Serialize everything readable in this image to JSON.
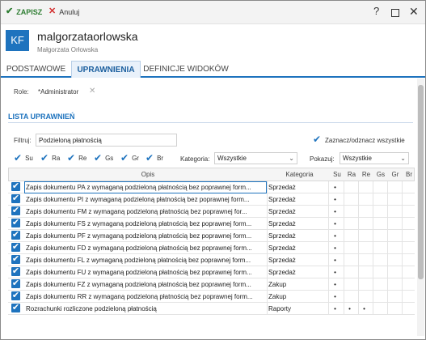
{
  "toolbar": {
    "save_label": "ZAPISZ",
    "cancel_label": "Anuluj",
    "help": "?"
  },
  "user": {
    "initials": "KF",
    "login": "malgorzataorlowska",
    "full_name": "Małgorzata Orłowska"
  },
  "tabs": [
    "PODSTAWOWE",
    "UPRAWNIENIA",
    "DEFINICJE WIDOKÓW"
  ],
  "roles": {
    "label": "Role:",
    "value": "*Administrator"
  },
  "section": {
    "title": "LISTA UPRAWNIEŃ"
  },
  "filter": {
    "label": "Filtruj:",
    "value": "Podzieloną płatnością",
    "select_all_label": "Zaznacz/odznacz wszystkie"
  },
  "rights": [
    "Su",
    "Ra",
    "Re",
    "Gs",
    "Gr",
    "Br"
  ],
  "category_filter": {
    "label": "Kategoria:",
    "value": "Wszystkie"
  },
  "show_filter": {
    "label": "Pokazuj:",
    "value": "Wszystkie"
  },
  "table": {
    "headers": {
      "desc": "Opis",
      "cat": "Kategoria",
      "r": [
        "Su",
        "Ra",
        "Re",
        "Gs",
        "Gr",
        "Br"
      ]
    },
    "rows": [
      {
        "desc": "Zapis dokumentu PA z wymaganą podzieloną płatnością bez poprawnej form...",
        "cat": "Sprzedaż",
        "r": [
          "•",
          "",
          "",
          "",
          "",
          ""
        ]
      },
      {
        "desc": "Zapis dokumentu PI z wymaganą podzieloną płatnością bez poprawnej form...",
        "cat": "Sprzedaż",
        "r": [
          "•",
          "",
          "",
          "",
          "",
          ""
        ]
      },
      {
        "desc": "Zapis dokumentu FM z wymaganą podzieloną płatnością bez poprawnej for...",
        "cat": "Sprzedaż",
        "r": [
          "•",
          "",
          "",
          "",
          "",
          ""
        ]
      },
      {
        "desc": "Zapis dokumentu FS z wymaganą podzieloną płatnością bez poprawnej form...",
        "cat": "Sprzedaż",
        "r": [
          "•",
          "",
          "",
          "",
          "",
          ""
        ]
      },
      {
        "desc": "Zapis dokumentu PF z wymaganą podzieloną płatnością bez poprawnej form...",
        "cat": "Sprzedaż",
        "r": [
          "•",
          "",
          "",
          "",
          "",
          ""
        ]
      },
      {
        "desc": "Zapis dokumentu FD z wymaganą podzieloną płatnością bez poprawnej form...",
        "cat": "Sprzedaż",
        "r": [
          "•",
          "",
          "",
          "",
          "",
          ""
        ]
      },
      {
        "desc": "Zapis dokumentu FL z wymaganą podzieloną płatnością bez poprawnej form...",
        "cat": "Sprzedaż",
        "r": [
          "•",
          "",
          "",
          "",
          "",
          ""
        ]
      },
      {
        "desc": "Zapis dokumentu FU z wymaganą podzieloną płatnością bez poprawnej form...",
        "cat": "Sprzedaż",
        "r": [
          "•",
          "",
          "",
          "",
          "",
          ""
        ]
      },
      {
        "desc": "Zapis dokumentu FZ z wymaganą podzieloną płatnością bez poprawnej form...",
        "cat": "Zakup",
        "r": [
          "•",
          "",
          "",
          "",
          "",
          ""
        ]
      },
      {
        "desc": "Zapis dokumentu RR z wymaganą podzieloną płatnością bez poprawnej form...",
        "cat": "Zakup",
        "r": [
          "•",
          "",
          "",
          "",
          "",
          ""
        ]
      },
      {
        "desc": "Rozrachunki rozliczone podzieloną płatnością",
        "cat": "Raporty",
        "r": [
          "•",
          "•",
          "•",
          "",
          "",
          ""
        ]
      }
    ]
  },
  "colors": {
    "accent": "#1e73be",
    "save": "#2e7d32",
    "cancel": "#d32f2f"
  }
}
